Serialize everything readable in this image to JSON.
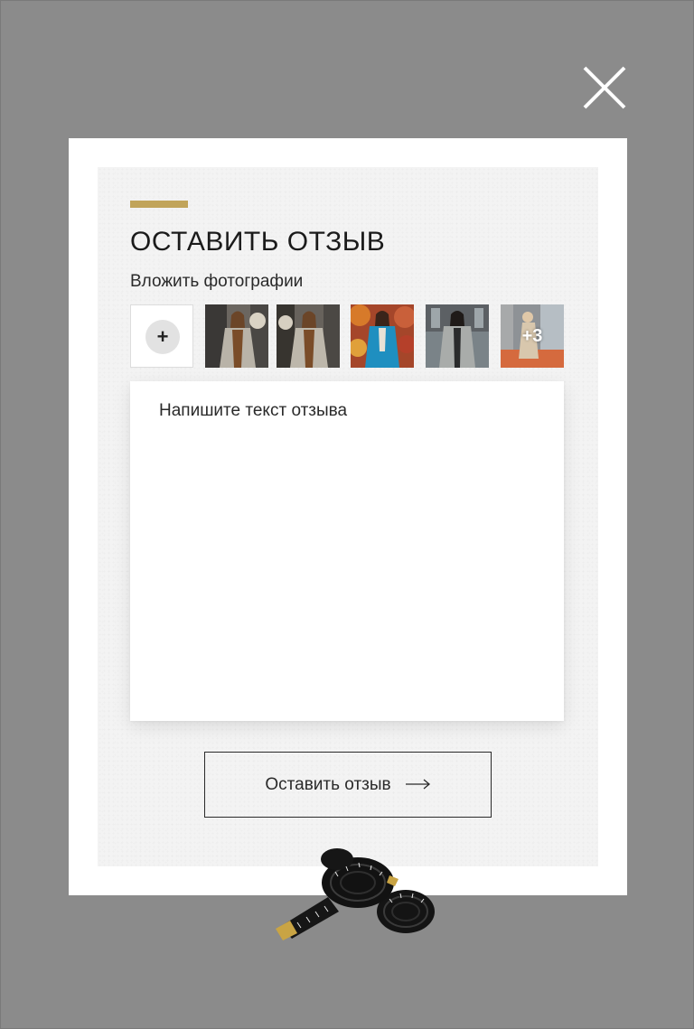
{
  "modal": {
    "title": "ОСТАВИТЬ ОТЗЫВ",
    "photos_label": "Вложить фотографии",
    "add_photo_symbol": "+",
    "extra_photos_count": "+3",
    "review_placeholder": "Напишите текст отзыва",
    "review_value": "",
    "submit_label": "Оставить отзыв",
    "submit_arrow": "⟶"
  },
  "photos": [
    {
      "name": "woman-checked-coat-1"
    },
    {
      "name": "woman-checked-coat-2"
    },
    {
      "name": "woman-blue-suit"
    },
    {
      "name": "woman-grey-coat"
    },
    {
      "name": "woman-beige-suit-orange-car"
    }
  ],
  "icons": {
    "close": "close-icon",
    "add": "plus-icon",
    "arrow": "arrow-right-icon",
    "decoration": "measuring-tape-icon"
  },
  "colors": {
    "overlay": "#8b8b8b",
    "accent": "#c1a45a",
    "panel": "#f3f3f3",
    "text": "#1b1b1b"
  }
}
